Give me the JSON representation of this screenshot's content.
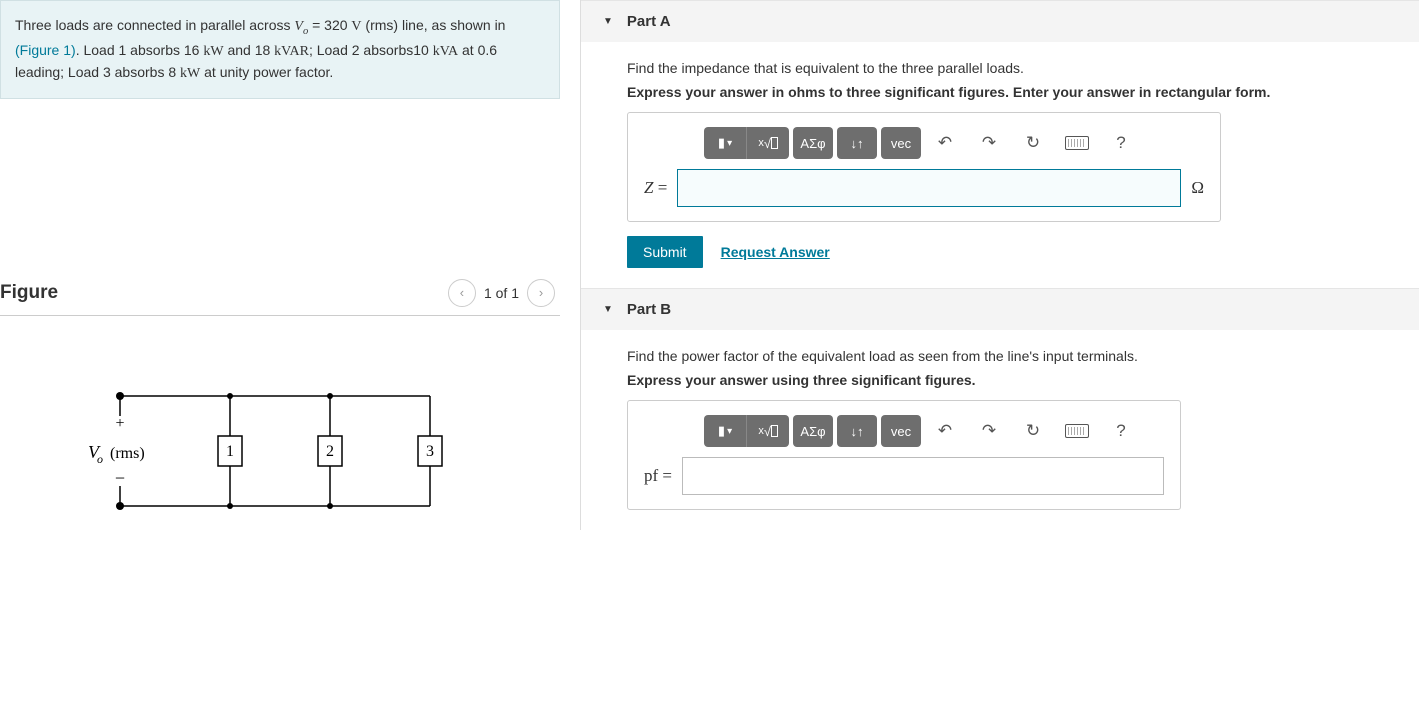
{
  "problem": {
    "text_pre": "Three loads are connected in parallel across ",
    "Vo_sym": "V",
    "Vo_sub": "o",
    "Vo_eq": " = 320 ",
    "Vo_unit": "V",
    "rms": " (rms) line, as shown in ",
    "figlink": "(Figure 1)",
    "after_fig": ". Load 1 absorbs 16 ",
    "kW": "kW",
    "and": " and 18 ",
    "kVAR": "kVAR",
    "semi": "; Load 2 absorbs10 ",
    "kVA": "kVA",
    "lead": " at 0.6 leading; Load 3 absorbs 8 ",
    "kW2": "kW",
    "unity": " at unity power factor."
  },
  "figure": {
    "title": "Figure",
    "count": "1 of 1",
    "vo_label": "V",
    "vo_sub": "o",
    "rms_label": "(rms)"
  },
  "partA": {
    "title": "Part A",
    "prompt": "Find the impedance that is equivalent to the three parallel loads.",
    "instruct": "Express your answer in ohms to three significant figures. Enter your answer in rectangular form.",
    "var": "Z",
    "eq": " = ",
    "unit": "Ω"
  },
  "partB": {
    "title": "Part B",
    "prompt": "Find the power factor of the equivalent load as seen from the line's input terminals.",
    "instruct": "Express your answer using three significant figures.",
    "var": "pf",
    "eq": " = "
  },
  "toolbar": {
    "templates": "▮",
    "sqrt": "√",
    "greek": "ΑΣφ",
    "subsup": "↓↑",
    "vec": "vec",
    "undo": "↶",
    "redo": "↷",
    "reset": "↻",
    "help": "?"
  },
  "actions": {
    "submit": "Submit",
    "request": "Request Answer"
  }
}
